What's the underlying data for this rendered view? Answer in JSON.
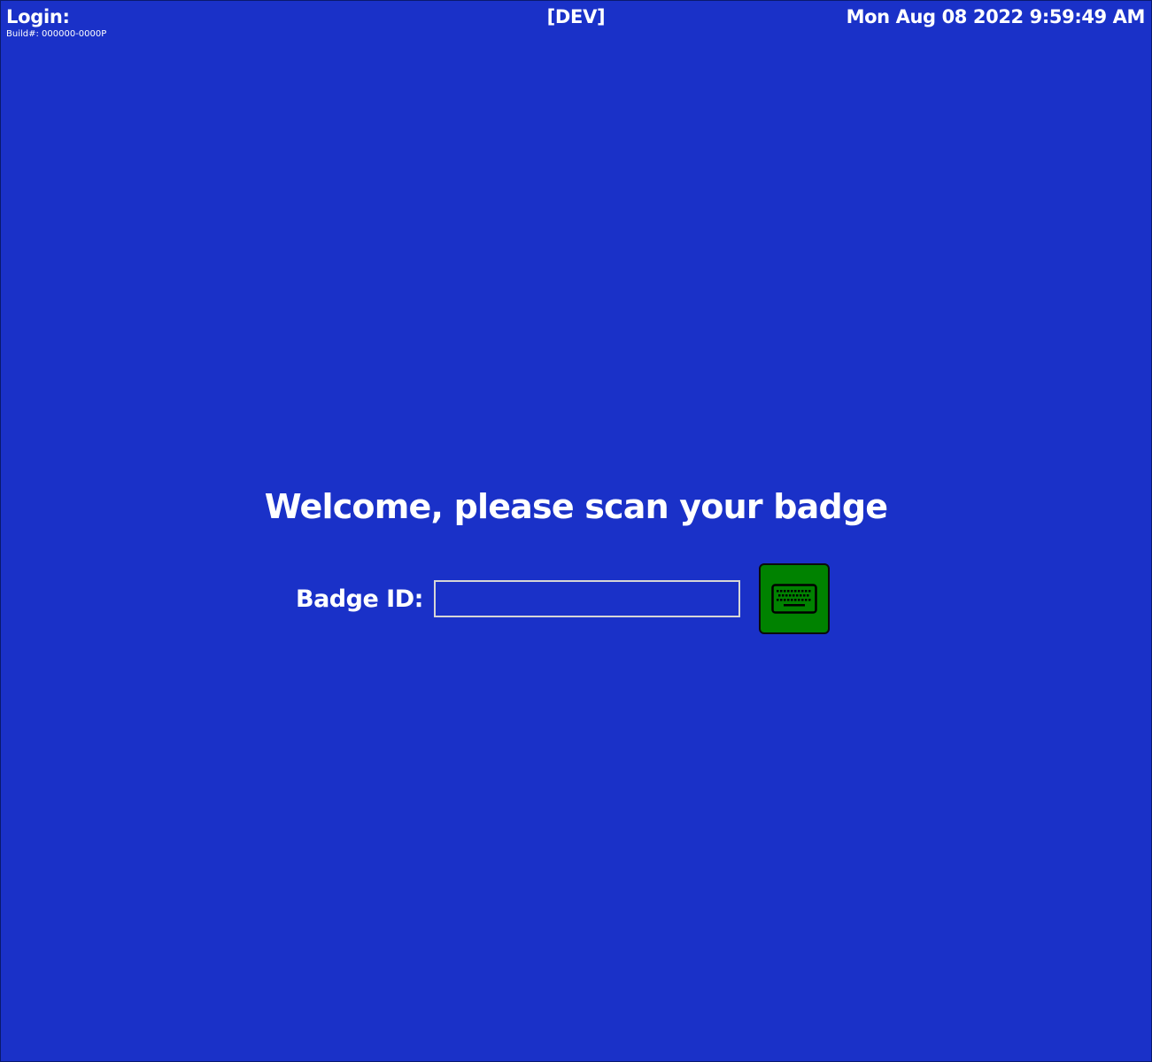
{
  "header": {
    "title": "Login:",
    "build": "Build#: 000000-0000P",
    "environment": "[DEV]",
    "datetime": "Mon Aug 08 2022 9:59:49 AM"
  },
  "main": {
    "welcome": "Welcome, please scan your badge",
    "badge_label": "Badge ID:",
    "badge_value": "",
    "keyboard_button_icon": "keyboard-icon"
  },
  "colors": {
    "background": "#1a31c8",
    "keyboard_button": "#008200",
    "text": "#ffffff"
  }
}
